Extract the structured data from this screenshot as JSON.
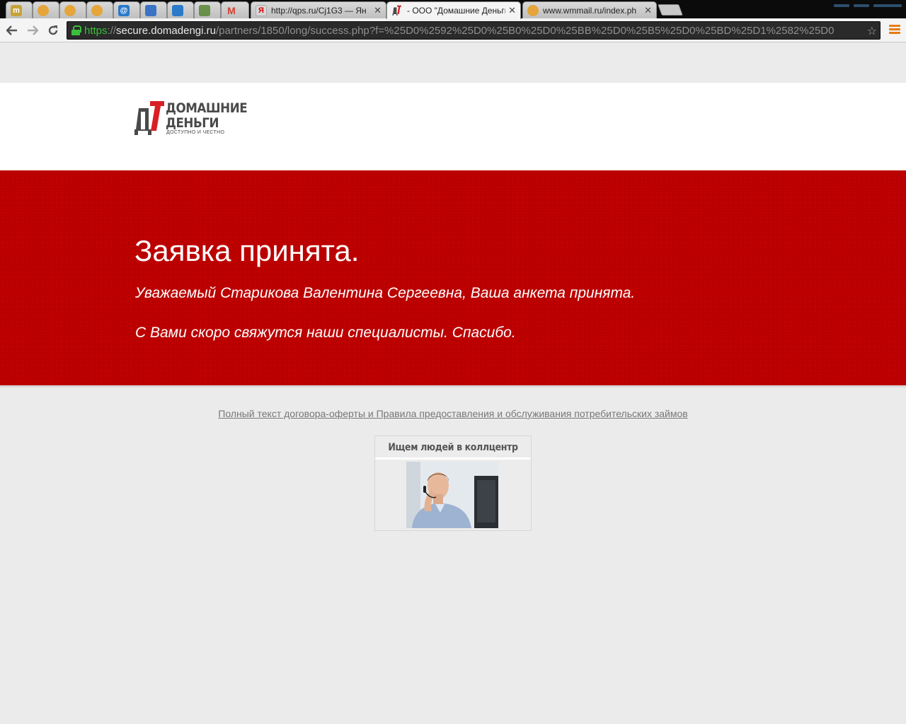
{
  "browser": {
    "tabs": [
      {
        "title": "",
        "icon": "tm-icon",
        "color": "#c7a23a"
      },
      {
        "title": "",
        "icon": "webmoney-icon",
        "color": "#e5a53a"
      },
      {
        "title": "",
        "icon": "webmoney-icon",
        "color": "#e5a53a"
      },
      {
        "title": "",
        "icon": "webmoney-icon",
        "color": "#e5a53a"
      },
      {
        "title": "",
        "icon": "mail-at-icon",
        "color": "#2a7ac9"
      },
      {
        "title": "",
        "icon": "globe-icon",
        "color": "#3a73c4"
      },
      {
        "title": "",
        "icon": "pin-icon",
        "color": "#2a7ac9"
      },
      {
        "title": "",
        "icon": "image-icon",
        "color": "#6a8f4a"
      },
      {
        "title": "",
        "icon": "gmail-icon",
        "color": "#d24032"
      },
      {
        "title": "http://qps.ru/Cj1G3 — Ян",
        "icon": "yandex-icon",
        "color": "#d8d8d8",
        "close": "✕"
      },
      {
        "title": "- ООО \"Домашние Деньги",
        "icon": "dd-logo-icon",
        "color": "#d91f26",
        "close": "✕"
      },
      {
        "title": "www.wmmail.ru/index.ph",
        "icon": "webmoney-icon",
        "color": "#e5a53a",
        "close": "✕"
      }
    ],
    "url": {
      "scheme": "https",
      "separator": "://",
      "host": "secure.domadengi.ru",
      "path": "/partners/1850/long/success.php?f=%25D0%2592%25D0%25B0%25D0%25BB%25D0%25B5%25D0%25BD%25D1%2582%25D0"
    }
  },
  "header": {
    "logo": {
      "line1": "ДОМАШНИЕ",
      "line2": "ДЕНЬГИ",
      "tagline": "ДОСТУПНО И ЧЕСТНО",
      "mark_dark": "#4a4a4a",
      "mark_red": "#d91f26"
    }
  },
  "banner": {
    "title": "Заявка принята.",
    "message1": "Уважаемый Старикова Валентина Сергеевна, Ваша анкета принята.",
    "message2": "С Вами скоро свяжутся наши специалисты. Спасибо.",
    "color": "#bd0000"
  },
  "footer": {
    "offer_link": "Полный текст договора-оферты и Правила предоставления и обслуживания потребительских займов"
  },
  "ad": {
    "title": "Ищем людей в коллцентр"
  }
}
